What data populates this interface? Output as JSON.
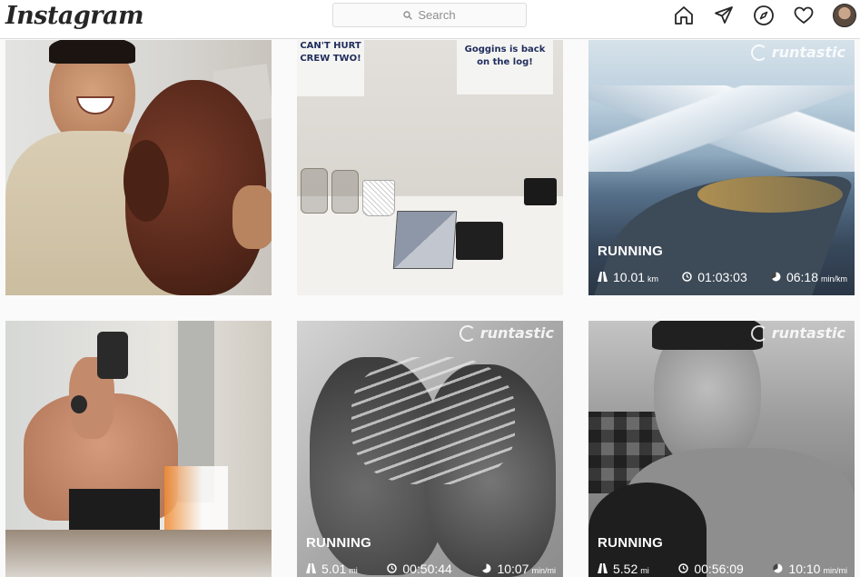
{
  "header": {
    "logo": "Instagram",
    "search_placeholder": "Search",
    "icons": [
      "home-icon",
      "direct-message-icon",
      "explore-compass-icon",
      "activity-heart-icon",
      "profile-avatar"
    ]
  },
  "posts": [
    {
      "subject": "Selfie with brown poodle"
    },
    {
      "notes": [
        "CAN'T HURT",
        "CREW TWO!",
        "Goggins is back",
        "on the log!"
      ]
    },
    {
      "brand": "runtastic",
      "activity": "RUNNING",
      "distance": "10.01",
      "distance_unit": "km",
      "duration": "01:03:03",
      "pace": "06:18",
      "pace_unit": "min/km"
    },
    {
      "subject": "Mirror selfie"
    },
    {
      "brand": "runtastic",
      "activity": "RUNNING",
      "distance": "5.01",
      "distance_unit": "mi",
      "duration": "00:50:44",
      "pace": "10:07",
      "pace_unit": "min/mi"
    },
    {
      "brand": "runtastic",
      "activity": "RUNNING",
      "distance": "5.52",
      "distance_unit": "mi",
      "duration": "00:56:09",
      "pace": "10:10",
      "pace_unit": "min/mi"
    }
  ],
  "colors": {
    "header_bg": "#ffffff",
    "page_bg": "#fafafa",
    "text_primary": "#262626",
    "text_muted": "#8e8e8e",
    "border": "#dbdbdb"
  }
}
